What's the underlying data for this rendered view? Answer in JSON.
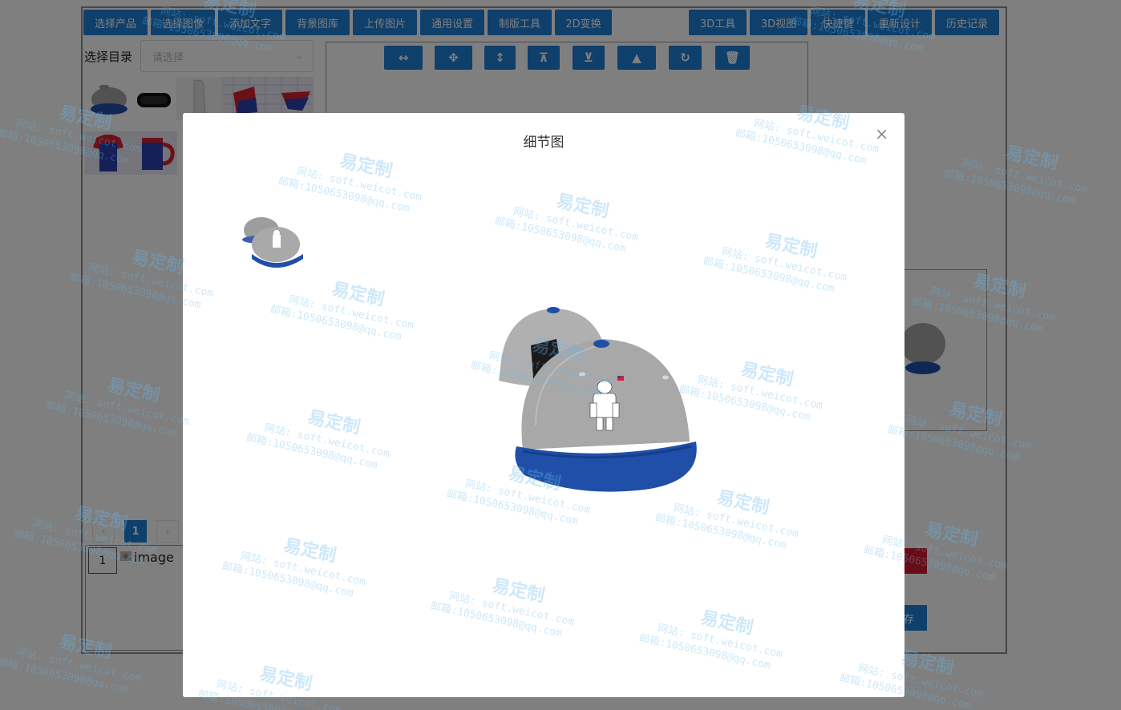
{
  "toolbar": {
    "left_buttons": [
      "选择产品",
      "选择图像",
      "添加文字",
      "背景图库",
      "上传图片",
      "通用设置",
      "制版工具",
      "2D变换"
    ],
    "right_buttons": [
      "3D工具",
      "3D视图",
      "快捷键",
      "重新设计",
      "历史记录"
    ]
  },
  "directory": {
    "label": "选择目录",
    "placeholder": "请选择"
  },
  "pagination": {
    "prev": "‹",
    "current": "1",
    "next": "›"
  },
  "layers": [
    {
      "index": "1",
      "name": "image"
    }
  ],
  "save_label": "保存",
  "modal": {
    "title": "细节图",
    "close": "×"
  },
  "watermark": {
    "title": "易定制",
    "site": "网站: soft.weicot.com",
    "email": "邮箱:1050653098@qq.com"
  },
  "colors": {
    "accent": "#1e7fd6",
    "swatch": "#d11a2a",
    "cap_gray": "#a6a6a6",
    "cap_blue": "#1f4fa8"
  }
}
